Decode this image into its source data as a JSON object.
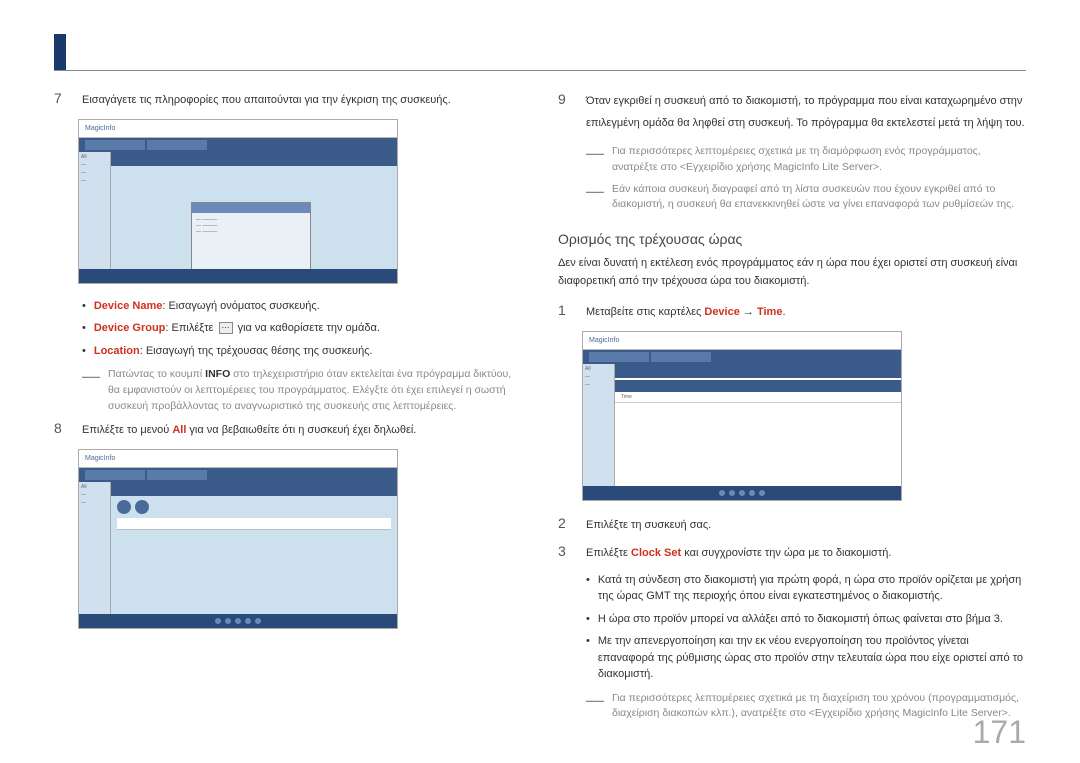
{
  "page_number": "171",
  "left": {
    "step7": {
      "num": "7",
      "text": "Εισαγάγετε τις πληροφορίες που απαιτούνται για την έγκριση της συσκευής."
    },
    "bullets": {
      "b1_label": "Device Name",
      "b1_text": ": Εισαγωγή ονόματος συσκευής.",
      "b2_label": "Device Group",
      "b2_pre": ": Επιλέξτε ",
      "b2_post": " για να καθορίσετε την ομάδα.",
      "b3_label": "Location",
      "b3_text": ": Εισαγωγή της τρέχουσας θέσης της συσκευής."
    },
    "note_info": {
      "text": "Πατώντας το κουμπί INFO στο τηλεχειριστήριο όταν εκτελείται ένα πρόγραμμα δικτύου, θα εμφανιστούν οι λεπτομέρειες του προγράμματος. Ελέγξτε ότι έχει επιλεγεί η σωστή συσκευή προβάλλοντας το αναγνωριστικό της συσκευής στις λεπτομέρειες.",
      "bold": "INFO"
    },
    "step8": {
      "num": "8",
      "text_pre": "Επιλέξτε το μενού ",
      "text_bold": "All",
      "text_post": " για να βεβαιωθείτε ότι η συσκευή έχει δηλωθεί."
    },
    "ss_logo": "MagicInfo"
  },
  "right": {
    "step9": {
      "num": "9",
      "text": "Όταν εγκριθεί η συσκευή από το διακομιστή, το πρόγραμμα που είναι καταχωρημένο στην επιλεγμένη ομάδα θα ληφθεί στη συσκευή. Το πρόγραμμα θα εκτελεστεί μετά τη λήψη του."
    },
    "note1": "Για περισσότερες λεπτομέρειες σχετικά με τη διαμόρφωση ενός προγράμματος, ανατρέξτε στο <Εγχειρίδιο χρήσης MagicInfo Lite Server>.",
    "note2": "Εάν κάποια συσκευή διαγραφεί από τη λίστα συσκευών που έχουν εγκριθεί από το διακομιστή, η συσκευή θα επανεκκινηθεί ώστε να γίνει επαναφορά των ρυθμίσεών της.",
    "heading": "Ορισμός της τρέχουσας ώρας",
    "heading_desc": "Δεν είναι δυνατή η εκτέλεση ενός προγράμματος εάν η ώρα που έχει οριστεί στη συσκευή είναι διαφορετική από την τρέχουσα ώρα του διακομιστή.",
    "step1": {
      "num": "1",
      "pre": "Μεταβείτε στις καρτέλες ",
      "a": "Device",
      "arrow": " → ",
      "b": "Time",
      "post": "."
    },
    "step2": {
      "num": "2",
      "text": "Επιλέξτε τη συσκευή σας."
    },
    "step3": {
      "num": "3",
      "pre": "Επιλέξτε ",
      "bold": "Clock Set",
      "post": " και συγχρονίστε την ώρα με το διακομιστή."
    },
    "bullets2": {
      "b1": "Κατά τη σύνδεση στο διακομιστή για πρώτη φορά, η ώρα στο προϊόν ορίζεται με χρήση της ώρας GMT της περιοχής όπου είναι εγκατεστημένος ο διακομιστής.",
      "b2": "Η ώρα στο προϊόν μπορεί να αλλάξει από το διακομιστή όπως φαίνεται στο βήμα 3.",
      "b3": "Με την απενεργοποίηση και την εκ νέου ενεργοποίηση του προϊόντος γίνεται επαναφορά της ρύθμισης ώρας στο προϊόν στην τελευταία ώρα που είχε οριστεί από το διακομιστή."
    },
    "note3": "Για περισσότερες λεπτομέρειες σχετικά με τη διαχείριση του χρόνου (προγραμματισμός, διαχείριση διακοπών κλπ.), ανατρέξτε στο <Εγχειρίδιο χρήσης MagicInfo Lite Server>."
  }
}
